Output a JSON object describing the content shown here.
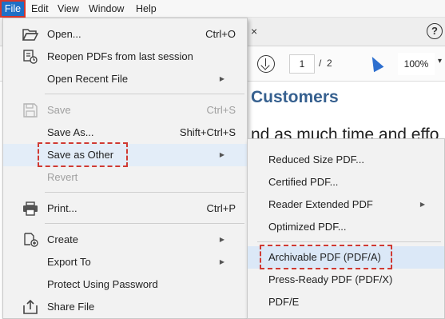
{
  "menubar": {
    "file": "File",
    "edit": "Edit",
    "view": "View",
    "window": "Window",
    "help": "Help"
  },
  "background": {
    "tab_close": "×",
    "help_glyph": "?",
    "page_current": "1",
    "page_separator": "/",
    "page_total": "2",
    "zoom": "100%",
    "heading": "Customers",
    "body_text": "nd as much time and effo"
  },
  "file_menu": {
    "items": [
      {
        "label": "Open...",
        "shortcut": "Ctrl+O",
        "icon": "folder-open-icon"
      },
      {
        "label": "Reopen PDFs from last session",
        "icon": "reopen-pdfs-icon"
      },
      {
        "label": "Open Recent File",
        "submenu": true
      },
      {
        "label": "Save",
        "shortcut": "Ctrl+S",
        "disabled": true,
        "icon": "save-disk-icon"
      },
      {
        "label": "Save As...",
        "shortcut": "Shift+Ctrl+S"
      },
      {
        "label": "Save as Other",
        "submenu": true,
        "highlighted": true
      },
      {
        "label": "Revert",
        "disabled": true
      },
      {
        "label": "Print...",
        "shortcut": "Ctrl+P",
        "icon": "printer-icon"
      },
      {
        "label": "Create",
        "submenu": true,
        "icon": "create-pdf-icon"
      },
      {
        "label": "Export To",
        "submenu": true
      },
      {
        "label": "Protect Using Password"
      },
      {
        "label": "Share File",
        "icon": "share-icon"
      }
    ]
  },
  "save_as_other_menu": {
    "items": [
      {
        "label": "Reduced Size PDF..."
      },
      {
        "label": "Certified PDF..."
      },
      {
        "label": "Reader Extended PDF",
        "submenu": true
      },
      {
        "label": "Optimized PDF..."
      },
      {
        "label": "Archivable PDF (PDF/A)",
        "highlighted": true
      },
      {
        "label": "Press-Ready PDF (PDF/X)"
      },
      {
        "label": "PDF/E"
      }
    ]
  },
  "colors": {
    "accent": "#1f6fc5",
    "annotation_red": "#d03a33",
    "heading_blue": "#36608f",
    "menu_bg": "#f2f2f2",
    "highlight": "#e3edf8"
  }
}
